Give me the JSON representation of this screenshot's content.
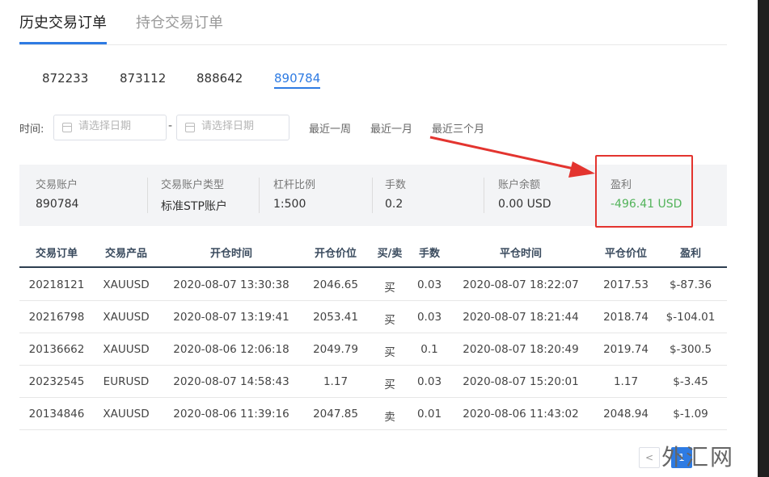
{
  "tabs": [
    {
      "label": "历史交易订单",
      "active": true
    },
    {
      "label": "持仓交易订单",
      "active": false
    }
  ],
  "accounts": [
    {
      "label": "872233",
      "active": false
    },
    {
      "label": "873112",
      "active": false
    },
    {
      "label": "888642",
      "active": false
    },
    {
      "label": "890784",
      "active": true
    }
  ],
  "filter": {
    "time_label": "时间:",
    "start_placeholder": "请选择日期",
    "end_placeholder": "请选择日期",
    "separator": "-",
    "quick_ranges": [
      "最近一周",
      "最近一月",
      "最近三个月"
    ]
  },
  "summary": {
    "account": {
      "label": "交易账户",
      "value": "890784"
    },
    "account_type": {
      "label": "交易账户类型",
      "value": "标准STP账户"
    },
    "leverage": {
      "label": "杠杆比例",
      "value": "1:500"
    },
    "lots": {
      "label": "手数",
      "value": "0.2"
    },
    "balance": {
      "label": "账户余额",
      "value": "0.00 USD"
    },
    "profit": {
      "label": "盈利",
      "value": "-496.41 USD"
    }
  },
  "table": {
    "headers": [
      "交易订单",
      "交易产品",
      "开仓时间",
      "开仓价位",
      "买/卖",
      "手数",
      "平仓时间",
      "平仓价位",
      "盈利"
    ],
    "rows": [
      [
        "20218121",
        "XAUUSD",
        "2020-08-07 13:30:38",
        "2046.65",
        "买",
        "0.03",
        "2020-08-07 18:22:07",
        "2017.53",
        "$-87.36"
      ],
      [
        "20216798",
        "XAUUSD",
        "2020-08-07 13:19:41",
        "2053.41",
        "买",
        "0.03",
        "2020-08-07 18:21:44",
        "2018.74",
        "$-104.01"
      ],
      [
        "20136662",
        "XAUUSD",
        "2020-08-06 12:06:18",
        "2049.79",
        "买",
        "0.1",
        "2020-08-07 18:20:49",
        "2019.74",
        "$-300.5"
      ],
      [
        "20232545",
        "EURUSD",
        "2020-08-07 14:58:43",
        "1.17",
        "买",
        "0.03",
        "2020-08-07 15:20:01",
        "1.17",
        "$-3.45"
      ],
      [
        "20134846",
        "XAUUSD",
        "2020-08-06 11:39:16",
        "2047.85",
        "卖",
        "0.01",
        "2020-08-06 11:43:02",
        "2048.94",
        "$-1.09"
      ]
    ]
  },
  "pagination": {
    "prev": "<",
    "current": "1"
  },
  "site_watermark": "外汇网",
  "colors": {
    "accent": "#2e7be3",
    "profit_negative": "#52b35a",
    "highlight": "#e3342f"
  }
}
